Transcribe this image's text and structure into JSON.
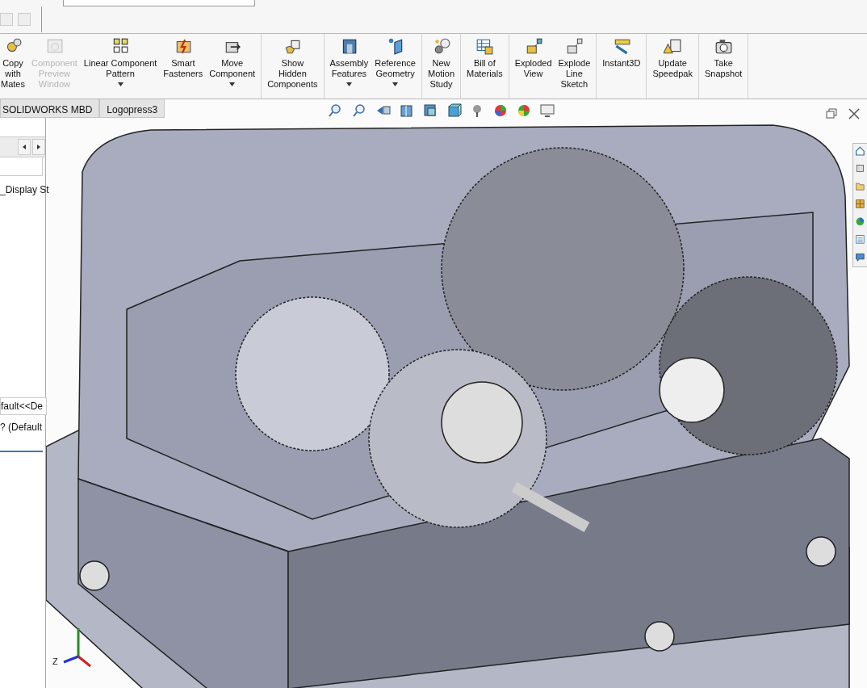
{
  "toolbar": {
    "groups": [
      {
        "buttons": [
          {
            "label": "Copy\nwith\nMates",
            "disabled": false,
            "dropdown": false
          },
          {
            "label": "Component\nPreview\nWindow",
            "disabled": true,
            "dropdown": false
          },
          {
            "label": "Linear Component\nPattern",
            "disabled": false,
            "dropdown": true
          },
          {
            "label": "Smart\nFasteners",
            "disabled": false,
            "dropdown": false
          },
          {
            "label": "Move\nComponent",
            "disabled": false,
            "dropdown": true
          }
        ]
      },
      {
        "buttons": [
          {
            "label": "Show\nHidden\nComponents",
            "disabled": false,
            "dropdown": false
          }
        ]
      },
      {
        "buttons": [
          {
            "label": "Assembly\nFeatures",
            "disabled": false,
            "dropdown": true
          },
          {
            "label": "Reference\nGeometry",
            "disabled": false,
            "dropdown": true
          }
        ]
      },
      {
        "buttons": [
          {
            "label": "New\nMotion\nStudy",
            "disabled": false,
            "dropdown": false
          }
        ]
      },
      {
        "buttons": [
          {
            "label": "Bill of\nMaterials",
            "disabled": false,
            "dropdown": false
          }
        ]
      },
      {
        "buttons": [
          {
            "label": "Exploded\nView",
            "disabled": false,
            "dropdown": false
          },
          {
            "label": "Explode\nLine\nSketch",
            "disabled": false,
            "dropdown": false
          }
        ]
      },
      {
        "buttons": [
          {
            "label": "Instant3D",
            "disabled": false,
            "dropdown": false
          }
        ]
      },
      {
        "buttons": [
          {
            "label": "Update\nSpeedpak",
            "disabled": false,
            "dropdown": false
          }
        ]
      },
      {
        "buttons": [
          {
            "label": "Take\nSnapshot",
            "disabled": false,
            "dropdown": false
          }
        ]
      }
    ]
  },
  "tabs": [
    {
      "label": "SOLIDWORKS MBD"
    },
    {
      "label": "Logopress3"
    }
  ],
  "feature_tree": {
    "items": [
      {
        "label": "_Display St",
        "selected": false
      },
      {
        "label": "fault<<De",
        "selected": true
      },
      {
        "label": "? (Default",
        "selected": false
      }
    ]
  },
  "viewport": {
    "axis_label": "Z"
  }
}
